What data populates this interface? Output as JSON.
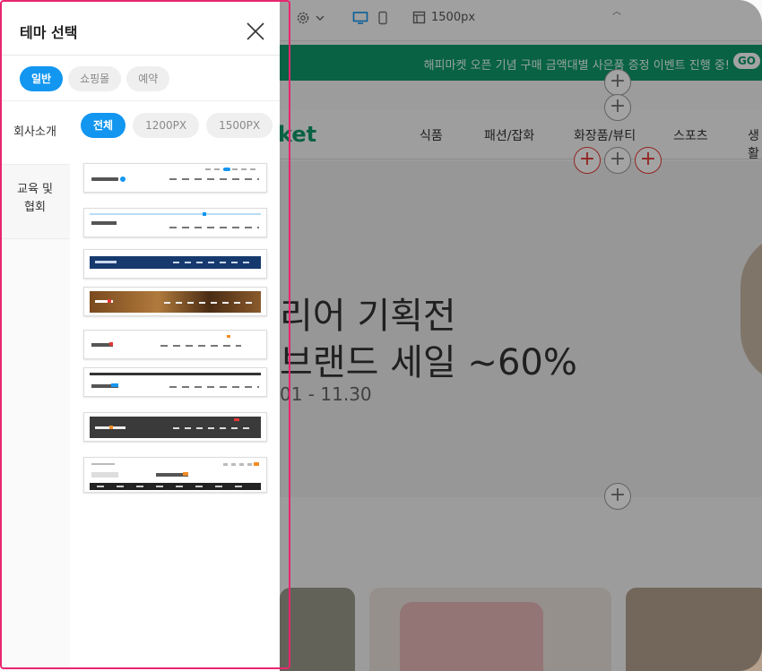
{
  "panel": {
    "title": "테마 선택",
    "category_tabs": [
      {
        "label": "일반",
        "active": true
      },
      {
        "label": "쇼핑몰",
        "active": false
      },
      {
        "label": "예약",
        "active": false
      }
    ],
    "sidebar": [
      {
        "label": "회사소개",
        "active": true
      },
      {
        "label": "교육 및 협회",
        "active": false
      }
    ],
    "size_tabs": [
      {
        "label": "전체",
        "active": true
      },
      {
        "label": "1200PX",
        "active": false
      },
      {
        "label": "1500PX",
        "active": false
      }
    ],
    "theme_count": 8
  },
  "background": {
    "toolbar": {
      "width_label": "1500px"
    },
    "banner": {
      "text": "해피마켓 오픈 기념 구매 금액대별 사은품 증정 이벤트 진행 중!",
      "go": "GO"
    },
    "nav": {
      "logo": "ket",
      "items": [
        "식품",
        "패션/잡화",
        "화장품/뷰티",
        "스포츠",
        "생활"
      ]
    },
    "hero": {
      "line1": "리어 기획전",
      "line2": "브랜드 세일 ~60%",
      "date": "01 - 11.30"
    }
  },
  "colors": {
    "accent": "#1296f0",
    "highlight": "#e8266e",
    "banner": "#0e9a6a"
  }
}
